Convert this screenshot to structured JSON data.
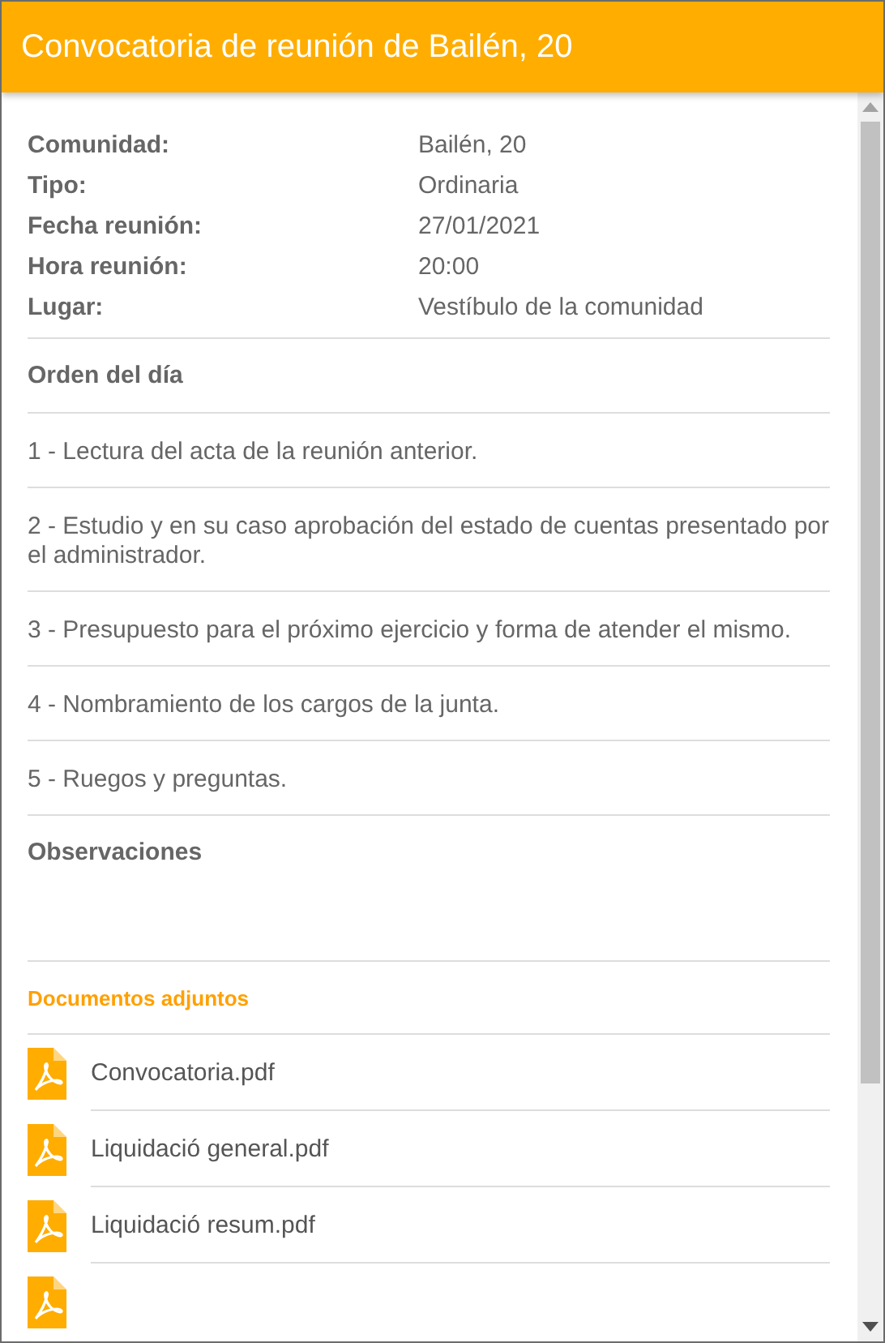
{
  "header": {
    "title": "Convocatoria de reunión de Bailén, 20"
  },
  "details": [
    {
      "label": "Comunidad:",
      "value": "Bailén, 20"
    },
    {
      "label": "Tipo:",
      "value": "Ordinaria"
    },
    {
      "label": "Fecha reunión:",
      "value": "27/01/2021"
    },
    {
      "label": "Hora reunión:",
      "value": "20:00"
    },
    {
      "label": "Lugar:",
      "value": "Vestíbulo de la comunidad"
    }
  ],
  "agenda": {
    "heading": "Orden del día",
    "items": [
      "1 - Lectura del acta de la reunión anterior.",
      "2 - Estudio y en su caso aprobación del estado de cuentas presentado por el administrador.",
      "3 - Presupuesto para el próximo ejercicio y forma de atender el mismo.",
      "4 - Nombramiento de los cargos de la junta.",
      "5 - Ruegos y preguntas."
    ]
  },
  "observations": {
    "heading": "Observaciones"
  },
  "attachments": {
    "heading": "Documentos adjuntos",
    "files": [
      "Convocatoria.pdf",
      "Liquidació general.pdf",
      "Liquidació resum.pdf"
    ]
  }
}
